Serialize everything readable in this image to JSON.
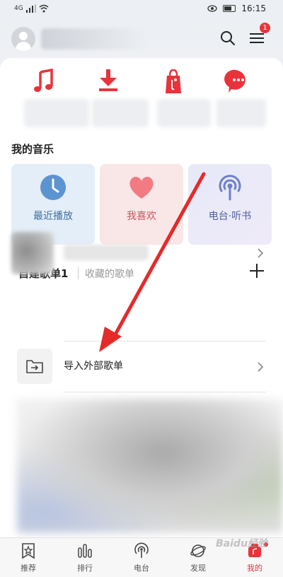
{
  "status_bar": {
    "network": "4G",
    "time": "16:15"
  },
  "header": {
    "menu_badge": "1"
  },
  "my_music": {
    "title": "我的音乐",
    "cards": [
      {
        "label": "最近播放",
        "icon": "clock-icon"
      },
      {
        "label": "我喜欢",
        "icon": "heart-icon"
      },
      {
        "label": "电台·听书",
        "icon": "radio-icon"
      }
    ]
  },
  "playlist_tabs": {
    "created": "自建歌单1",
    "collected": "收藏的歌单"
  },
  "import": {
    "label": "导入外部歌单"
  },
  "tabbar": {
    "items": [
      {
        "label": "推荐"
      },
      {
        "label": "排行"
      },
      {
        "label": "电台"
      },
      {
        "label": "发现"
      },
      {
        "label": "我的"
      }
    ]
  },
  "colors": {
    "accent": "#e8333b"
  },
  "watermark": "Baidu经验"
}
